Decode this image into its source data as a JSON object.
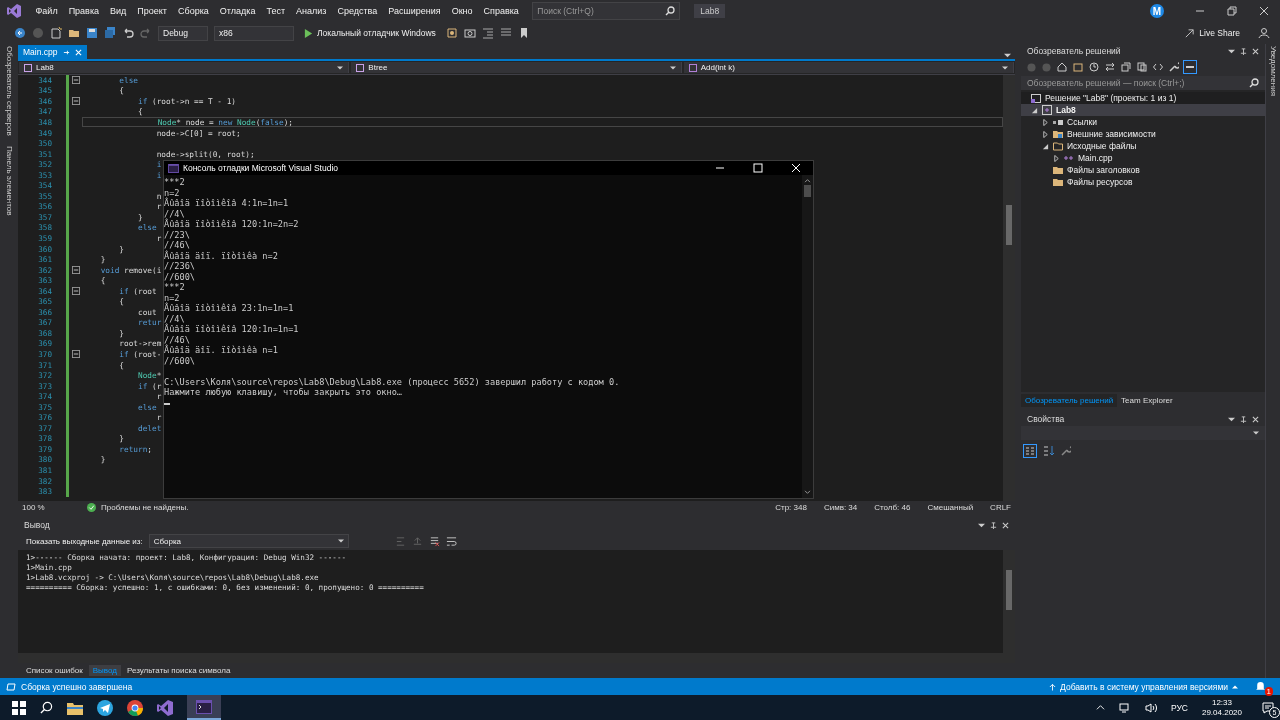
{
  "title_bar": {
    "menus": [
      "Файл",
      "Правка",
      "Вид",
      "Проект",
      "Сборка",
      "Отладка",
      "Тест",
      "Анализ",
      "Средства",
      "Расширения",
      "Окно",
      "Справка"
    ],
    "search": {
      "placeholder": "Поиск (Ctrl+Q)"
    },
    "solution_name": "Lab8",
    "avatar": "M"
  },
  "toolbar": {
    "configuration": "Debug",
    "platform": "x86",
    "run_label": "Локальный отладчик Windows",
    "live_share": "Live Share"
  },
  "left_rail": [
    "Обозреватель серверов",
    "Панель элементов"
  ],
  "editor": {
    "tabs": [
      {
        "label": "Main.cpp",
        "selected": true
      }
    ],
    "nav": [
      "Lab8",
      "Btree",
      "Add(int k)"
    ],
    "lines": [
      {
        "num": "344",
        "code": [
          {
            "kind": "kw",
            "text": "        else"
          }
        ],
        "fold": true,
        "current": false
      },
      {
        "num": "345",
        "code": [
          {
            "kind": "plain",
            "text": "        {"
          }
        ],
        "fold": false,
        "current": false
      },
      {
        "num": "346",
        "code": [
          {
            "kind": "kw",
            "text": "            if"
          },
          {
            "kind": "plain",
            "text": " (root->n == T - 1)"
          }
        ],
        "fold": true,
        "current": false
      },
      {
        "num": "347",
        "code": [
          {
            "kind": "plain",
            "text": "            {"
          }
        ],
        "fold": false,
        "current": false
      },
      {
        "num": "348",
        "code": [
          {
            "kind": "type",
            "text": "                Node"
          },
          {
            "kind": "plain",
            "text": "* node = "
          },
          {
            "kind": "kw",
            "text": "new"
          },
          {
            "kind": "type",
            "text": " Node"
          },
          {
            "kind": "plain",
            "text": "("
          },
          {
            "kind": "kw",
            "text": "false"
          },
          {
            "kind": "plain",
            "text": ");"
          }
        ],
        "fold": false,
        "current": true
      },
      {
        "num": "349",
        "code": [
          {
            "kind": "plain",
            "text": "                node->C[0] = root;"
          }
        ],
        "fold": false,
        "current": false
      },
      {
        "num": "350",
        "fold": false,
        "current": false
      },
      {
        "num": "351",
        "code": [
          {
            "kind": "plain",
            "text": "                node->split(0, root);"
          }
        ],
        "fold": false,
        "current": false
      },
      {
        "num": "352",
        "code": [
          {
            "kind": "kw",
            "text": "                i"
          }
        ],
        "fold": false,
        "current": false
      },
      {
        "num": "353",
        "code": [
          {
            "kind": "kw",
            "text": "                i"
          }
        ],
        "fold": false,
        "current": false
      },
      {
        "num": "354",
        "fold": false,
        "current": false
      },
      {
        "num": "355",
        "code": [
          {
            "kind": "plain",
            "text": "                n"
          }
        ],
        "fold": false,
        "current": false
      },
      {
        "num": "356",
        "code": [
          {
            "kind": "plain",
            "text": "                r"
          }
        ],
        "fold": false,
        "current": false
      },
      {
        "num": "357",
        "code": [
          {
            "kind": "plain",
            "text": "            }"
          }
        ],
        "fold": false,
        "current": false
      },
      {
        "num": "358",
        "code": [
          {
            "kind": "kw",
            "text": "            else"
          }
        ],
        "fold": false,
        "current": false
      },
      {
        "num": "359",
        "code": [
          {
            "kind": "plain",
            "text": "                r"
          }
        ],
        "fold": false,
        "current": false
      },
      {
        "num": "360",
        "code": [
          {
            "kind": "plain",
            "text": "        }"
          }
        ],
        "fold": false,
        "current": false
      },
      {
        "num": "361",
        "code": [
          {
            "kind": "plain",
            "text": "    }"
          }
        ],
        "fold": false,
        "current": false
      },
      {
        "num": "362",
        "code": [
          {
            "kind": "kw",
            "text": "    void"
          },
          {
            "kind": "plain",
            "text": " remove(i"
          }
        ],
        "fold": true,
        "current": false
      },
      {
        "num": "363",
        "code": [
          {
            "kind": "plain",
            "text": "    {"
          }
        ],
        "fold": false,
        "current": false
      },
      {
        "num": "364",
        "code": [
          {
            "kind": "kw",
            "text": "        if"
          },
          {
            "kind": "plain",
            "text": " (root"
          }
        ],
        "fold": true,
        "current": false
      },
      {
        "num": "365",
        "code": [
          {
            "kind": "plain",
            "text": "        {"
          }
        ],
        "fold": false,
        "current": false
      },
      {
        "num": "366",
        "code": [
          {
            "kind": "plain",
            "text": "            cout"
          }
        ],
        "fold": false,
        "current": false
      },
      {
        "num": "367",
        "code": [
          {
            "kind": "kw",
            "text": "            retur"
          }
        ],
        "fold": false,
        "current": false
      },
      {
        "num": "368",
        "code": [
          {
            "kind": "plain",
            "text": "        }"
          }
        ],
        "fold": false,
        "current": false
      },
      {
        "num": "369",
        "code": [
          {
            "kind": "plain",
            "text": "        root->rem"
          }
        ],
        "fold": false,
        "current": false
      },
      {
        "num": "370",
        "code": [
          {
            "kind": "kw",
            "text": "        if"
          },
          {
            "kind": "plain",
            "text": " (root-"
          }
        ],
        "fold": true,
        "current": false
      },
      {
        "num": "371",
        "code": [
          {
            "kind": "plain",
            "text": "        {"
          }
        ],
        "fold": false,
        "current": false
      },
      {
        "num": "372",
        "code": [
          {
            "kind": "type",
            "text": "            Node"
          },
          {
            "kind": "plain",
            "text": "*"
          }
        ],
        "fold": false,
        "current": false
      },
      {
        "num": "373",
        "code": [
          {
            "kind": "kw",
            "text": "            if"
          },
          {
            "kind": "plain",
            "text": " (r"
          }
        ],
        "fold": false,
        "current": false
      },
      {
        "num": "374",
        "code": [
          {
            "kind": "plain",
            "text": "                r"
          }
        ],
        "fold": false,
        "current": false
      },
      {
        "num": "375",
        "code": [
          {
            "kind": "kw",
            "text": "            else"
          }
        ],
        "fold": false,
        "current": false
      },
      {
        "num": "376",
        "code": [
          {
            "kind": "plain",
            "text": "                r"
          }
        ],
        "fold": false,
        "current": false
      },
      {
        "num": "377",
        "code": [
          {
            "kind": "kw",
            "text": "            delet"
          }
        ],
        "fold": false,
        "current": false
      },
      {
        "num": "378",
        "code": [
          {
            "kind": "plain",
            "text": "        }"
          }
        ],
        "fold": false,
        "current": false
      },
      {
        "num": "379",
        "code": [
          {
            "kind": "kw",
            "text": "        return"
          },
          {
            "kind": "plain",
            "text": ";"
          }
        ],
        "fold": false,
        "current": false
      },
      {
        "num": "380",
        "code": [
          {
            "kind": "plain",
            "text": "    }"
          }
        ],
        "fold": false,
        "current": false
      },
      {
        "num": "381",
        "fold": false,
        "current": false
      },
      {
        "num": "382",
        "fold": false,
        "current": false
      },
      {
        "num": "383",
        "fold": false,
        "current": false
      }
    ],
    "zoom": "100 %",
    "problems": "Проблемы не найдены.",
    "position": [
      "Стр: 348",
      "Симв: 34",
      "Столб: 46",
      "Смешанный",
      "CRLF"
    ]
  },
  "console": {
    "title": "Консоль отладки Microsoft Visual Studio",
    "lines": [
      "***2",
      "n=2",
      "Âûâîä ïîòîìêîâ 4:1n=1n=1",
      "//4\\",
      "Âûâîä ïîòîìêîâ 120:1n=2n=2",
      "//23\\",
      "//46\\",
      "Âûâîä äîï. ïîòîìêà n=2",
      "//236\\",
      "//600\\",
      "***2",
      "n=2",
      "Âûâîä ïîòîìêîâ 23:1n=1n=1",
      "//4\\",
      "Âûâîä ïîòîìêîâ 120:1n=1n=1",
      "//46\\",
      "Âûâîä äîï. ïîòîìêà n=1",
      "//600\\"
    ],
    "exit_lines": [
      "C:\\Users\\Коля\\source\\repos\\Lab8\\Debug\\Lab8.exe (процесс 5652) завершил работу с кодом 0.",
      "Нажмите любую клавишу, чтобы закрыть это окно…"
    ]
  },
  "output": {
    "title": "Вывод",
    "source_label": "Показать выходные данные из:",
    "source": "Сборка",
    "lines": [
      "1>------ Сборка начата: проект: Lab8, Конфигурация: Debug Win32 ------",
      "1>Main.cpp",
      "1>Lab8.vcxproj -> C:\\Users\\Коля\\source\\repos\\Lab8\\Debug\\Lab8.exe",
      "========== Сборка: успешно: 1, с ошибками: 0, без изменений: 0, пропущено: 0 =========="
    ],
    "tabs": [
      {
        "label": "Список ошибок",
        "selected": false
      },
      {
        "label": "Вывод",
        "selected": true
      },
      {
        "label": "Результаты поиска символа",
        "selected": false
      }
    ]
  },
  "solution_explorer": {
    "title": "Обозреватель решений",
    "search": {
      "placeholder": "Обозреватель решений — поиск (Ctrl+;)"
    },
    "tree": [
      {
        "label": "Решение \"Lab8\" (проекты: 1 из 1)",
        "kind": "solution",
        "selected": false,
        "children": [
          {
            "label": "Lab8",
            "kind": "project",
            "selected": true,
            "expanded": true,
            "children": [
              {
                "label": "Ссылки",
                "kind": "references",
                "selected": false,
                "expanded": false
              },
              {
                "label": "Внешние зависимости",
                "kind": "dependencies",
                "selected": false,
                "expanded": false
              },
              {
                "label": "Исходные файлы",
                "kind": "open-folder",
                "selected": false,
                "expanded": true,
                "children": [
                  {
                    "label": "Main.cpp",
                    "kind": "cpp",
                    "selected": false,
                    "expanded": false
                  }
                ]
              },
              {
                "label": "Файлы заголовков",
                "kind": "folder",
                "selected": false
              },
              {
                "label": "Файлы ресурсов",
                "kind": "folder",
                "selected": false
              }
            ]
          }
        ]
      }
    ],
    "tabs": [
      {
        "label": "Обозреватель решений",
        "selected": true
      },
      {
        "label": "Team Explorer",
        "selected": false
      }
    ]
  },
  "properties": {
    "title": "Свойства"
  },
  "right_rail": "Уведомления",
  "status_bar": {
    "message": "Сборка успешно завершена",
    "source_control": "Добавить в систему управления версиями",
    "notifications": "1"
  },
  "taskbar": {
    "language": "РУС",
    "time": "12:33",
    "date": "29.04.2020",
    "notifications": "5"
  }
}
